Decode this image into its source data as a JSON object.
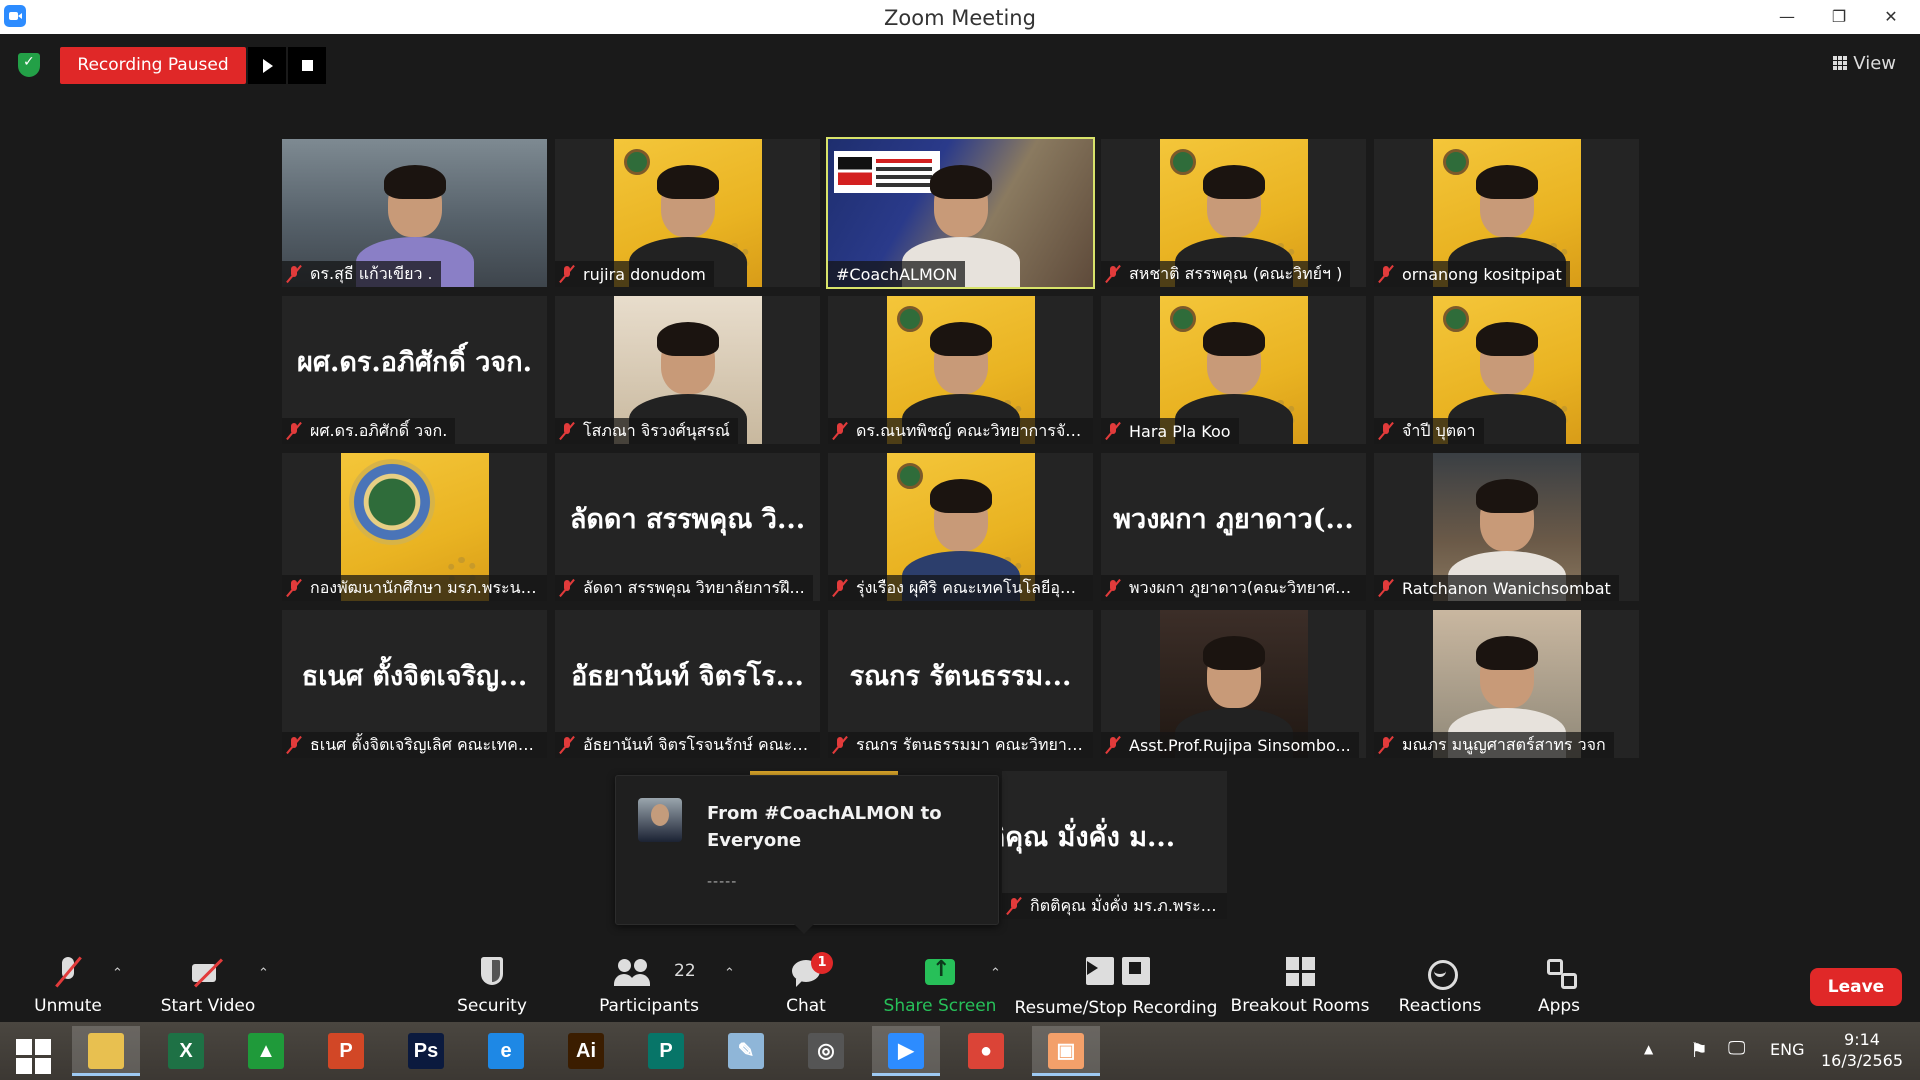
{
  "window": {
    "title": "Zoom Meeting"
  },
  "recording": {
    "status": "Recording Paused"
  },
  "view": {
    "label": "View"
  },
  "participants_grid": [
    {
      "name": "ดร.สุธี แก้วเขียว .",
      "video": "office",
      "body": "purple"
    },
    {
      "name": "rujira donudom",
      "video": "yellow",
      "body": "black"
    },
    {
      "name": "#CoachALMON",
      "video": "game",
      "body": "white",
      "active": true,
      "unmuted": true
    },
    {
      "name": "สหชาติ สรรพคุณ (คณะวิทย์ฯ )",
      "video": "yellow",
      "body": "black"
    },
    {
      "name": "ornanong kositpipat",
      "video": "yellow",
      "body": "black"
    },
    {
      "name": "ผศ.ดร.อภิศักดิ์ วจก.",
      "placeholder": "ผศ.ดร.อภิศักดิ์ วจก."
    },
    {
      "name": "โสภณา จิรวงศ์นุสรณ์",
      "video": "beige",
      "body": "black"
    },
    {
      "name": "ดร.ณนทพิชญ์ คณะวิทยาการจัด...",
      "video": "yellow",
      "body": "black"
    },
    {
      "name": "Hara Pla Koo",
      "video": "yellow",
      "body": "black"
    },
    {
      "name": "จำปี บุตดา",
      "video": "yellow",
      "body": "black"
    },
    {
      "name": "กองพัฒนานักศึกษา มรภ.พระนคร",
      "video": "seal"
    },
    {
      "name": "ลัดดา สรรพคุณ วิทยาลัยการฝึ...",
      "placeholder": "ลัดดา สรรพคุณ วิ..."
    },
    {
      "name": "รุ่งเรือง ผุศิริ คณะเทคโนโลยีอุตส...",
      "video": "yellow",
      "body": "blue"
    },
    {
      "name": "พวงผกา ภูยาดาว(คณะวิทยาศา...",
      "placeholder": "พวงผกา ภูยาดาว(..."
    },
    {
      "name": "Ratchanon Wanichsombat",
      "video": "cafe",
      "body": "white"
    },
    {
      "name": "ธเนศ ตั้งจิตเจริญเลิศ คณะเทคโน...",
      "placeholder": "ธเนศ ตั้งจิตเจริญ..."
    },
    {
      "name": "อัธยานันท์ จิตรโรจนรักษ์ คณะเท...",
      "placeholder": "อัธยานันท์ จิตรโร..."
    },
    {
      "name": "รณกร รัตนธรรมมา คณะวิทยาศ...",
      "placeholder": "รณกร รัตนธรรม..."
    },
    {
      "name": "Asst.Prof.Rujipa Sinsombo...",
      "video": "dark",
      "body": "black"
    },
    {
      "name": "มณภร มนูญศาสตร์สาทร วจก",
      "video": "room",
      "body": "white"
    }
  ],
  "hidden_tile": {
    "placeholder": "ตติคุณ มั่งคั่ง ม...",
    "name": "กิตติคุณ มั่งคั่ง มร.ภ.พระนคร"
  },
  "chat_popup": {
    "from": "From #CoachALMON to Everyone",
    "message": "-----"
  },
  "toolbar": {
    "unmute": "Unmute",
    "start_video": "Start Video",
    "security": "Security",
    "participants": "Participants",
    "participants_count": "22",
    "chat": "Chat",
    "chat_badge": "1",
    "share_screen": "Share Screen",
    "resume_stop_recording": "Resume/Stop Recording",
    "breakout_rooms": "Breakout Rooms",
    "reactions": "Reactions",
    "apps": "Apps",
    "leave": "Leave"
  },
  "taskbar": {
    "apps": [
      {
        "name": "file-explorer-icon",
        "glyph": "",
        "color": "#e8c050",
        "active": true
      },
      {
        "name": "excel-icon",
        "glyph": "X",
        "color": "#1e7145"
      },
      {
        "name": "publisher-store-icon",
        "glyph": "▲",
        "color": "#1f9a3a"
      },
      {
        "name": "powerpoint-icon",
        "glyph": "P",
        "color": "#d24726"
      },
      {
        "name": "photoshop-icon",
        "glyph": "Ps",
        "color": "#0b1a3e"
      },
      {
        "name": "internet-explorer-icon",
        "glyph": "e",
        "color": "#1e88e5"
      },
      {
        "name": "illustrator-icon",
        "glyph": "Ai",
        "color": "#3b1d00"
      },
      {
        "name": "publisher-icon",
        "glyph": "P",
        "color": "#077568"
      },
      {
        "name": "notepad-icon",
        "glyph": "✎",
        "color": "#8fb6d8"
      },
      {
        "name": "photoscape-icon",
        "glyph": "◎",
        "color": "#555555"
      },
      {
        "name": "zoom-icon",
        "glyph": "▶",
        "color": "#2d8cff",
        "active": true
      },
      {
        "name": "chrome-icon",
        "glyph": "●",
        "color": "#db4437"
      },
      {
        "name": "photos-icon",
        "glyph": "▣",
        "color": "#f3a06a",
        "active": true
      }
    ],
    "language": "ENG",
    "time": "9:14",
    "date": "16/3/2565"
  },
  "colors": {
    "accent_recording": "#e02828",
    "active_speaker_border": "#d8e36a",
    "share_green": "#27c059",
    "muted_red": "#e23b3b"
  }
}
